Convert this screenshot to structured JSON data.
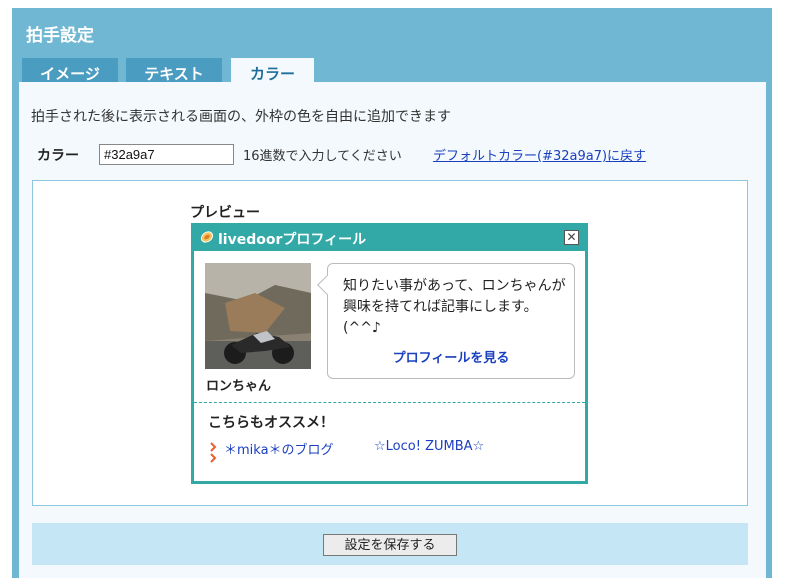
{
  "panel": {
    "title": "拍手設定"
  },
  "tabs": [
    {
      "label": "イメージ"
    },
    {
      "label": "テキスト"
    },
    {
      "label": "カラー"
    }
  ],
  "active_tab": "カラー",
  "description": "拍手された後に表示される画面の、外枠の色を自由に追加できます",
  "color_field": {
    "label": "カラー",
    "value": "#32a9a7",
    "hint": "16進数で入力してください",
    "reset_link": "デフォルトカラー(#32a9a7)に戻す"
  },
  "preview": {
    "label": "プレビュー",
    "widget": {
      "title": "livedoorプロフィール",
      "close_glyph": "✕",
      "user_name": "ロンちゃん",
      "bubble_text": "知りたい事があって、ロンちゃんが興味を持てれば記事にします。(^^♪",
      "profile_link": "プロフィールを見る",
      "recommend_title": "こちらもオススメ！",
      "recommend_items": [
        "＊mika＊のブログ",
        "☆Loco! ZUMBA☆"
      ]
    }
  },
  "save_button": "設定を保存する",
  "colors": {
    "frame": "#32a9a7",
    "panel": "#70b7d4",
    "tab": "#4a9cc0",
    "link": "#1a3fbf"
  },
  "icons": {
    "logo": "livedoor-logo-icon",
    "close": "close-icon",
    "bullet": "bullet-arrow-icon"
  }
}
